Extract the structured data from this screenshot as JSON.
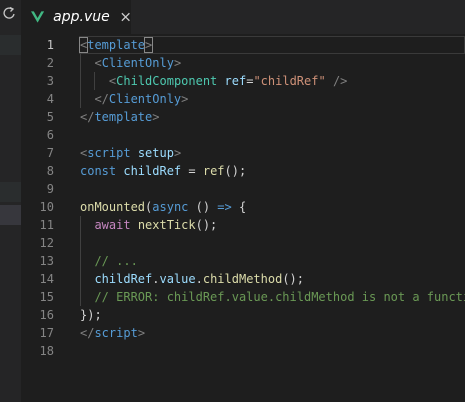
{
  "tab": {
    "filename": "app.vue",
    "accent": "#41b883"
  },
  "editor": {
    "active_line": 1,
    "lines": [
      {
        "n": "1",
        "tokens": [
          {
            "t": "<",
            "c": "t-punct bracket-box"
          },
          {
            "t": "template",
            "c": "t-tag"
          },
          {
            "t": ">",
            "c": "t-punct bracket-box"
          }
        ]
      },
      {
        "n": "2",
        "tokens": [
          {
            "t": "  ",
            "c": "t-plain"
          },
          {
            "t": "<",
            "c": "t-punct"
          },
          {
            "t": "ClientOnly",
            "c": "t-tag"
          },
          {
            "t": ">",
            "c": "t-punct"
          }
        ]
      },
      {
        "n": "3",
        "tokens": [
          {
            "t": "    ",
            "c": "t-plain"
          },
          {
            "t": "<",
            "c": "t-punct"
          },
          {
            "t": "ChildComponent",
            "c": "t-comp"
          },
          {
            "t": " ",
            "c": "t-plain"
          },
          {
            "t": "ref",
            "c": "t-attr"
          },
          {
            "t": "=",
            "c": "t-op"
          },
          {
            "t": "\"childRef\"",
            "c": "t-str"
          },
          {
            "t": " ",
            "c": "t-plain"
          },
          {
            "t": "/>",
            "c": "t-punct"
          }
        ]
      },
      {
        "n": "4",
        "tokens": [
          {
            "t": "  ",
            "c": "t-plain"
          },
          {
            "t": "</",
            "c": "t-punct"
          },
          {
            "t": "ClientOnly",
            "c": "t-tag"
          },
          {
            "t": ">",
            "c": "t-punct"
          }
        ]
      },
      {
        "n": "5",
        "tokens": [
          {
            "t": "</",
            "c": "t-punct"
          },
          {
            "t": "template",
            "c": "t-tag"
          },
          {
            "t": ">",
            "c": "t-punct"
          }
        ]
      },
      {
        "n": "6",
        "tokens": []
      },
      {
        "n": "7",
        "tokens": [
          {
            "t": "<",
            "c": "t-punct"
          },
          {
            "t": "script",
            "c": "t-tag"
          },
          {
            "t": " ",
            "c": "t-plain"
          },
          {
            "t": "setup",
            "c": "t-attr"
          },
          {
            "t": ">",
            "c": "t-punct"
          }
        ]
      },
      {
        "n": "8",
        "tokens": [
          {
            "t": "const",
            "c": "t-kw"
          },
          {
            "t": " ",
            "c": "t-plain"
          },
          {
            "t": "childRef",
            "c": "t-var"
          },
          {
            "t": " = ",
            "c": "t-op"
          },
          {
            "t": "ref",
            "c": "t-fn"
          },
          {
            "t": "();",
            "c": "t-plain"
          }
        ]
      },
      {
        "n": "9",
        "tokens": []
      },
      {
        "n": "10",
        "tokens": [
          {
            "t": "onMounted",
            "c": "t-fn"
          },
          {
            "t": "(",
            "c": "t-plain"
          },
          {
            "t": "async",
            "c": "t-kw"
          },
          {
            "t": " () ",
            "c": "t-plain"
          },
          {
            "t": "=>",
            "c": "t-kw"
          },
          {
            "t": " {",
            "c": "t-plain"
          }
        ]
      },
      {
        "n": "11",
        "tokens": [
          {
            "t": "  ",
            "c": "t-plain"
          },
          {
            "t": "await",
            "c": "t-ctl"
          },
          {
            "t": " ",
            "c": "t-plain"
          },
          {
            "t": "nextTick",
            "c": "t-fn"
          },
          {
            "t": "();",
            "c": "t-plain"
          }
        ]
      },
      {
        "n": "12",
        "tokens": []
      },
      {
        "n": "13",
        "tokens": [
          {
            "t": "  ",
            "c": "t-plain"
          },
          {
            "t": "// ...",
            "c": "t-cmt"
          }
        ]
      },
      {
        "n": "14",
        "tokens": [
          {
            "t": "  ",
            "c": "t-plain"
          },
          {
            "t": "childRef",
            "c": "t-var"
          },
          {
            "t": ".",
            "c": "t-plain"
          },
          {
            "t": "value",
            "c": "t-var"
          },
          {
            "t": ".",
            "c": "t-plain"
          },
          {
            "t": "childMethod",
            "c": "t-fn"
          },
          {
            "t": "();",
            "c": "t-plain"
          }
        ]
      },
      {
        "n": "15",
        "tokens": [
          {
            "t": "  ",
            "c": "t-plain"
          },
          {
            "t": "// ERROR: childRef.value.childMethod is not a function",
            "c": "t-cmt"
          }
        ]
      },
      {
        "n": "16",
        "tokens": [
          {
            "t": "});",
            "c": "t-plain"
          }
        ]
      },
      {
        "n": "17",
        "tokens": [
          {
            "t": "</",
            "c": "t-punct"
          },
          {
            "t": "script",
            "c": "t-tag"
          },
          {
            "t": ">",
            "c": "t-punct"
          }
        ]
      },
      {
        "n": "18",
        "tokens": []
      }
    ]
  },
  "sidebar": {
    "icons": [
      "refresh-icon"
    ]
  }
}
